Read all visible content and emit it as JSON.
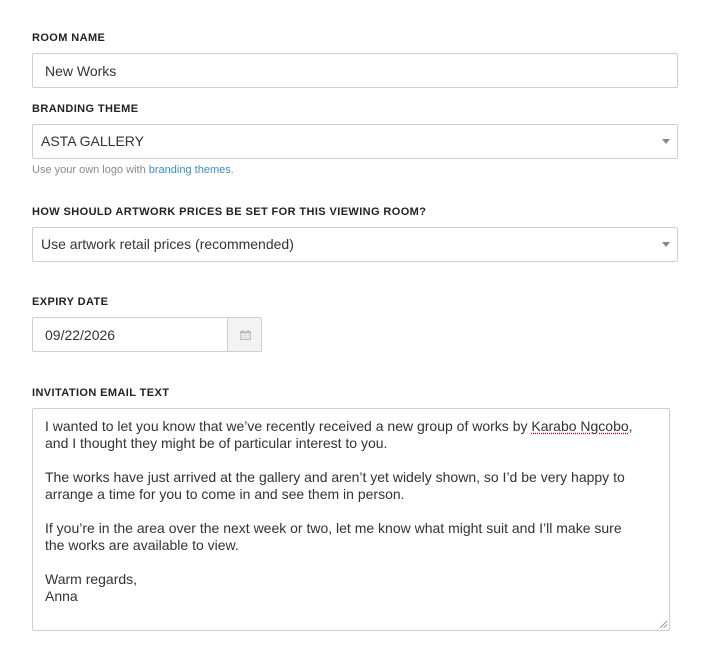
{
  "room_name": {
    "label": "ROOM NAME",
    "value": "New Works"
  },
  "branding_theme": {
    "label": "BRANDING THEME",
    "selected": "ASTA GALLERY",
    "help_prefix": "Use your own logo with ",
    "help_link": "branding themes",
    "help_suffix": "."
  },
  "pricing": {
    "label": "HOW SHOULD ARTWORK PRICES BE SET FOR THIS VIEWING ROOM?",
    "selected": "Use artwork retail prices (recommended)"
  },
  "expiry": {
    "label": "EXPIRY DATE",
    "value": "09/22/2026",
    "icon": "calendar-icon"
  },
  "invitation": {
    "label": "INVITATION EMAIL TEXT",
    "p1_l1_a": "I wanted to let you know that we’ve recently received a new group of works by ",
    "p1_l1_name": "Karabo Ngcobo",
    "p1_l1_b": ",",
    "p1_l2": "and I thought they might be of particular interest to you.",
    "p2_l1": "The works have just arrived at the gallery and aren’t yet widely shown, so I’d be very happy to",
    "p2_l2": "arrange a time for you to come in and see them in person.",
    "p3_l1": "If you’re in the area over the next week or two, let me know what might suit and I’ll make sure",
    "p3_l2": "the works are available to view.",
    "p4_l1": "Warm regards,",
    "p4_l2": "Anna"
  },
  "colors": {
    "link": "#3a8fc6",
    "border": "#cfcfcf",
    "spellcheck": "#d0021b"
  }
}
